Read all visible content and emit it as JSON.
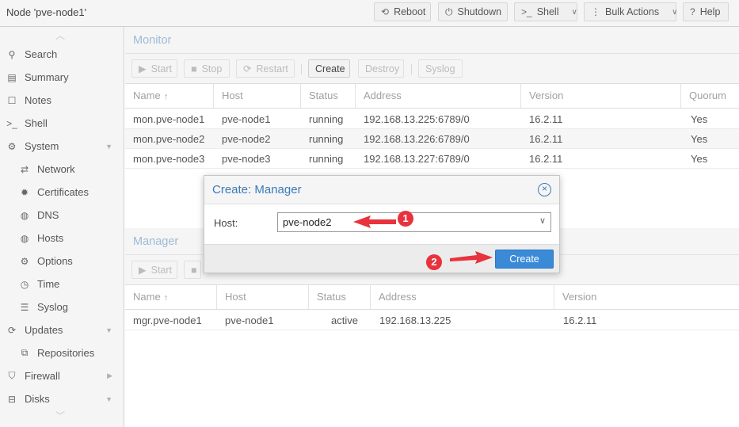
{
  "header": {
    "node_title": "Node 'pve-node1'",
    "reboot": "Reboot",
    "shutdown": "Shutdown",
    "shell": "Shell",
    "bulk_actions": "Bulk Actions",
    "help": "Help"
  },
  "sidebar": {
    "items": [
      {
        "label": "Search",
        "icon": "search-icon"
      },
      {
        "label": "Summary",
        "icon": "book-icon"
      },
      {
        "label": "Notes",
        "icon": "note-icon"
      },
      {
        "label": "Shell",
        "icon": "terminal-icon"
      },
      {
        "label": "System",
        "icon": "gears-icon"
      },
      {
        "label": "Network",
        "icon": "exchange-icon"
      },
      {
        "label": "Certificates",
        "icon": "certificate-icon"
      },
      {
        "label": "DNS",
        "icon": "globe-icon"
      },
      {
        "label": "Hosts",
        "icon": "globe-icon"
      },
      {
        "label": "Options",
        "icon": "gear-icon"
      },
      {
        "label": "Time",
        "icon": "clock-icon"
      },
      {
        "label": "Syslog",
        "icon": "list-icon"
      },
      {
        "label": "Updates",
        "icon": "refresh-icon"
      },
      {
        "label": "Repositories",
        "icon": "files-icon"
      },
      {
        "label": "Firewall",
        "icon": "shield-icon"
      },
      {
        "label": "Disks",
        "icon": "hdd-icon"
      }
    ]
  },
  "monitor": {
    "title": "Monitor",
    "buttons": {
      "start": "Start",
      "stop": "Stop",
      "restart": "Restart",
      "create": "Create",
      "destroy": "Destroy",
      "syslog": "Syslog"
    },
    "columns": [
      "Name",
      "Host",
      "Status",
      "Address",
      "Version",
      "Quorum"
    ],
    "rows": [
      [
        "mon.pve-node1",
        "pve-node1",
        "running",
        "192.168.13.225:6789/0",
        "16.2.11",
        "Yes"
      ],
      [
        "mon.pve-node2",
        "pve-node2",
        "running",
        "192.168.13.226:6789/0",
        "16.2.11",
        "Yes"
      ],
      [
        "mon.pve-node3",
        "pve-node3",
        "running",
        "192.168.13.227:6789/0",
        "16.2.11",
        "Yes"
      ]
    ]
  },
  "manager": {
    "title": "Manager",
    "buttons": {
      "start": "Start"
    },
    "columns": [
      "Name",
      "Host",
      "Status",
      "Address",
      "Version"
    ],
    "rows": [
      [
        "mgr.pve-node1",
        "pve-node1",
        "active",
        "192.168.13.225",
        "16.2.11"
      ]
    ]
  },
  "dialog": {
    "title": "Create: Manager",
    "host_label": "Host:",
    "host_value": "pve-node2",
    "create": "Create"
  },
  "annotations": {
    "step1": "1",
    "step2": "2",
    "color": "#e8323c"
  },
  "colors": {
    "accent": "#3a8ad8",
    "panel_title": "#9dbbd6"
  }
}
